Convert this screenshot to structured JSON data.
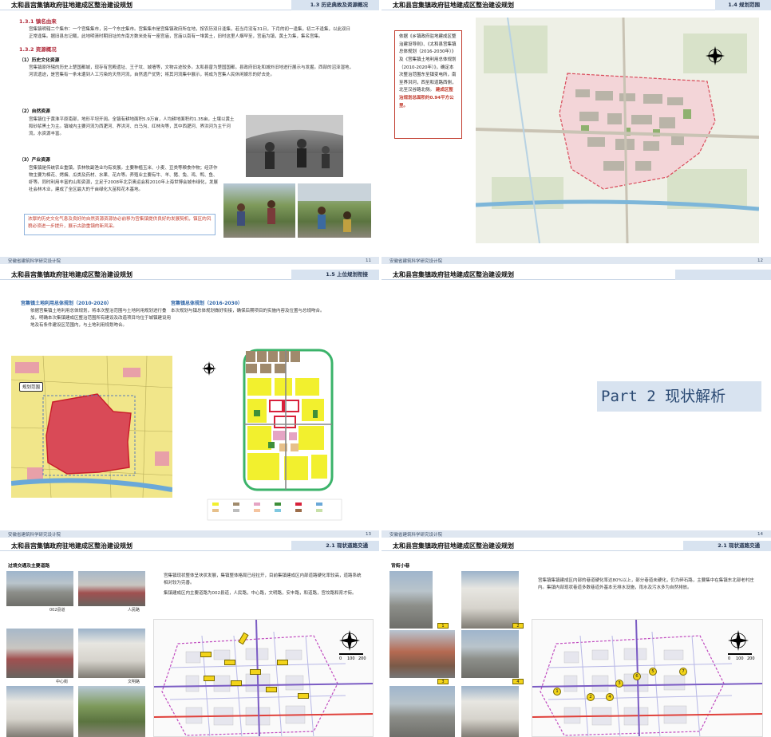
{
  "common": {
    "doc_title": "太和县宫集镇政府驻地建成区整治建设规划",
    "footer_org": "安徽省建筑科学研究设计院"
  },
  "p11": {
    "section": "1.3 历史典故及资源概况",
    "page_no": "11",
    "h_331": "1.3.1 镇名由来",
    "p_331": "宫集镇明辖二个集市：一个宫集集市，另一个东庄集市。宫集集市是宫集镇政府所在地，按农历双日逢集，若当月没有31日，下月的初一逢集，初二不逢集，以此双日正常逢集。据旧县志记载，此地明清时期旧址的东南方数米处有一座宫庙，宫庙以南有一堆黄土，旧时这里人烟罕至，宫庙为镇，黄土为集，集名宫集。",
    "h_332": "1.3.2 资源概况",
    "h_1": "（1）历史文化资源",
    "p_1": "宫集镇原所辖的历史上楚国都城，现存有宫殿遗址、王子坟、城墙等，文物古迹较多。太和县曾为楚国国都，县政府旧址和城外旧地进行展示与发掘。西部的沼泽湿地，河流遗迹，是宫集有一条未遭到人工污染的天然河流，自然遗产优势；将其河流集中展示，将成为宫集人民休闲娱乐的好去处。",
    "h_2": "（2）自然资源",
    "p_2": "宫集镇位于黄淮平原南部，地形平坦开阔。全镇有耕地面积5.9万亩，人均耕地面积约1.35亩，土壤以黄土和砂浆黑土为主。镇域内主要河流为西淝河、界洪河、白马沟、红林沟等，其中西淝河、界洪河为主干河流，水资源丰富。",
    "h_3": "（3）产业资源",
    "p_3": "宫集镇是传统农业重镇，农林牧副渔业均有发展。主要种植玉米、小麦、豆类等粮食作物；经济作物主要为棉花、烤烟、瓜类及药材、水果、花卉等。养殖业主要有牛、羊、猪、兔、鸡、鸭、鱼、虾等。同时利用丰富的山和资源，立足于2008年北京奥运会和2010年上海世博会城市绿化，发展社会林木业，建成了全区最大的千亩绿化大苗和花木基地。",
    "highlight": "浓厚的历史文化气息及良好的自然资源资源协必前移为宫集镇提供良好的发展契机，镇区的风貌必须进一步提升，展示古韵重镇的新风采。"
  },
  "p12": {
    "section": "1.4 规划范围",
    "page_no": "12",
    "intro": "依据《乡镇政府驻地建成区整治建设导则》、《太和县宫集镇总体规划（2016-2030年）》及《宫集镇土地利用总体规划（2010-2020年）》，确定本次整治范围东至镇变电所，南至界洪河，西至和道路西侧，北至汉谷路北侧。",
    "emph": "建成区整治规划总面积约0.94平方公里。"
  },
  "p13": {
    "section": "1.5 上位规划衔接",
    "page_no": "13",
    "left_h": "宫集镇土地利用总体规划（2010-2020）",
    "left_p": "依据宫集镇土地利用总体规划，将本次整治范围与土地利用规划进行叠加，明确本次集镇建成区整治范围所有建设及改造项目均位于城镇建设用地及有条件建设区范围内，与土地利用规划吻合。",
    "right_h": "宫集镇总体规划（2016-2030）",
    "right_p": "本次规划与镇总体规划做好衔接，确保后期项目的实施内容及位置与总规吻合。",
    "map_label": "规划范围"
  },
  "p14": {
    "page_no": "14",
    "part_title": "Part 2  现状解析"
  },
  "p15": {
    "section": "2.1 现状道路交通",
    "page_no": "15",
    "sub": "过境交通及主要道路",
    "p_a": "宫集镇现状整体呈块状发展，集镇整体格局已经拉开，目前集镇建成区内部道路硬化率较高，道路系统相对较为完善。",
    "p_b": "集镇建成区内主要道路为002县道，人民路，中心路，文明路，安丰路，和道路，宫坟路和育才街。",
    "caps": [
      "002县道",
      "人民路",
      "中心街",
      "文明路"
    ]
  },
  "p16": {
    "section": "2.1 现状道路交通",
    "page_no": "",
    "sub": "背街小巷",
    "p_a": "宫集镇集镇建成区内部的巷道硬化率达80%以上，部分巷道未硬化，仍为碎石路，主要集中在集镇东北部老村庄内。集镇内部现状巷道多数巷道外基本无排水设施，雨水及污水多为自然排放。",
    "nums": [
      "1",
      "2",
      "3",
      "4",
      "5",
      "6",
      "7"
    ]
  },
  "map_scale": [
    "0",
    "100",
    "200"
  ]
}
